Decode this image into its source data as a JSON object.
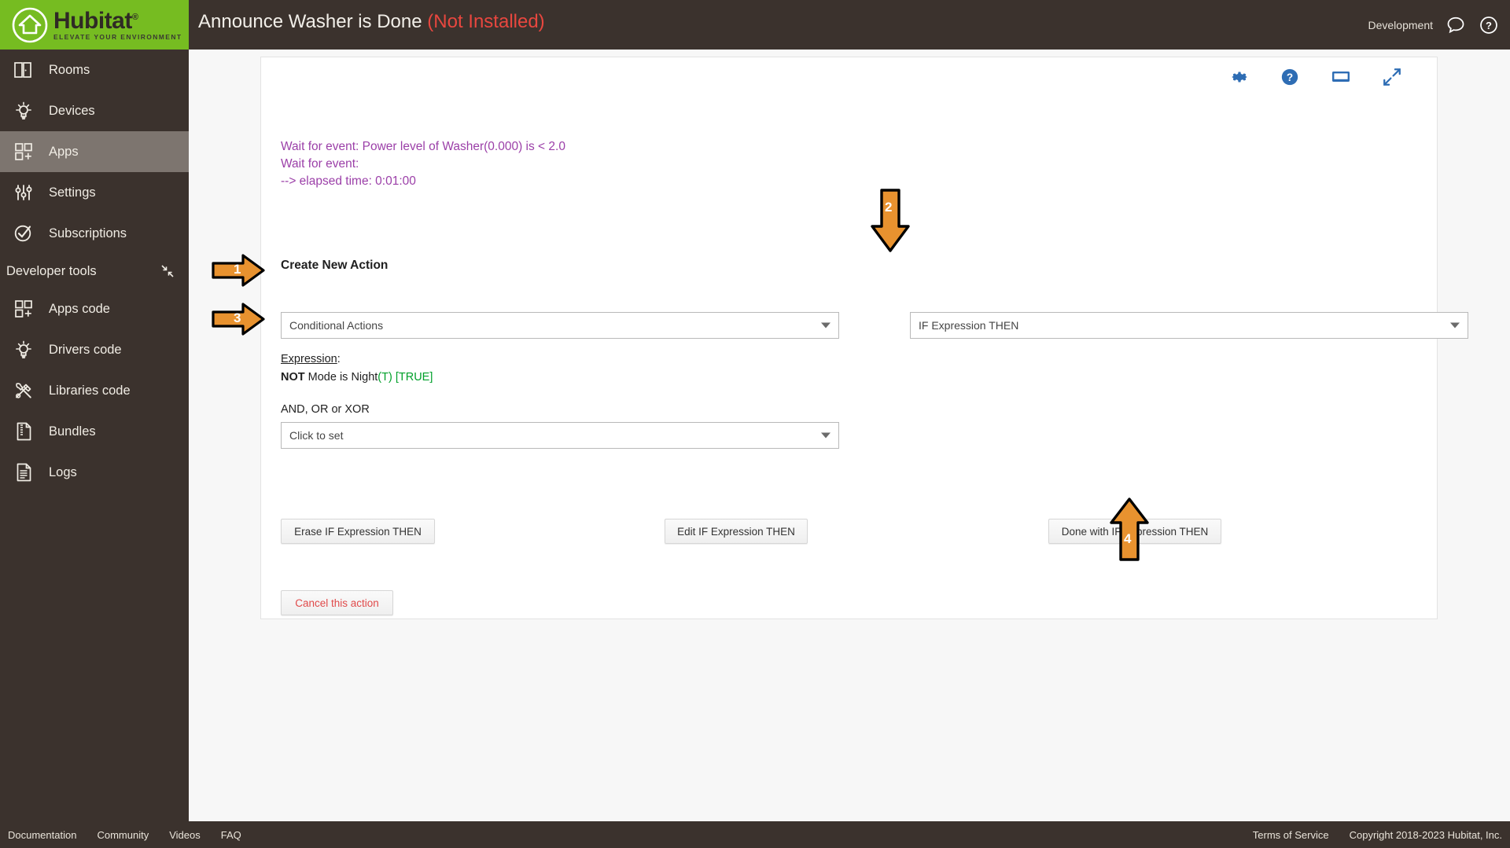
{
  "header": {
    "brand_name": "Hubitat",
    "brand_registered": "®",
    "brand_tagline": "ELEVATE YOUR ENVIRONMENT",
    "app_title": "Announce Washer is Done",
    "app_status": "(Not Installed)",
    "environment": "Development",
    "chat_icon": "chat-bubble-icon",
    "help_icon": "question-circle-icon",
    "brand_green": "#76bc21",
    "bar_color": "#3b322d"
  },
  "sidebar": {
    "items": [
      {
        "label": "Rooms",
        "icon": "rooms-icon",
        "active": false
      },
      {
        "label": "Devices",
        "icon": "devices-bulb-icon",
        "active": false
      },
      {
        "label": "Apps",
        "icon": "apps-grid-icon",
        "active": true
      },
      {
        "label": "Settings",
        "icon": "sliders-icon",
        "active": false
      },
      {
        "label": "Subscriptions",
        "icon": "check-circle-icon",
        "active": false
      }
    ],
    "section_label": "Developer tools",
    "collapse_icon": "collapse-arrows-icon",
    "dev_items": [
      {
        "label": "Apps code",
        "icon": "apps-grid-icon"
      },
      {
        "label": "Drivers code",
        "icon": "devices-bulb-icon"
      },
      {
        "label": "Libraries code",
        "icon": "tools-icon"
      },
      {
        "label": "Bundles",
        "icon": "zip-file-icon"
      },
      {
        "label": "Logs",
        "icon": "document-lines-icon"
      }
    ]
  },
  "card": {
    "tool_icons": [
      "gear-icon",
      "help-circle-icon",
      "display-icon",
      "expand-icon"
    ],
    "accent_blue": "#2e6db4",
    "log_lines": [
      "Wait for event: Power level of Washer(0.000) is < 2.0",
      "Wait for event:",
      " --> elapsed time: 0:01:00"
    ],
    "log_color": "#9b3fa8",
    "create_new_action": "Create New Action",
    "action_select": {
      "value": "Conditional Actions"
    },
    "type_select": {
      "value": "IF Expression THEN"
    },
    "expression_label": "Expression",
    "expression_colon": ":",
    "expression_not": "NOT",
    "expression_body": " Mode is Night",
    "expression_t": "(T)",
    "expression_true": " [TRUE]",
    "logic_label": "AND, OR or XOR",
    "logic_select": {
      "value": "Click to set"
    },
    "buttons": {
      "erase": "Erase IF Expression THEN",
      "edit": "Edit IF Expression THEN",
      "done": "Done with IF Expression THEN",
      "cancel": "Cancel this action"
    }
  },
  "annotations": {
    "color": "#e8922f",
    "markers": [
      {
        "number": "1",
        "direction": "right"
      },
      {
        "number": "2",
        "direction": "down"
      },
      {
        "number": "3",
        "direction": "right"
      },
      {
        "number": "4",
        "direction": "up"
      }
    ]
  },
  "footer": {
    "links": [
      "Documentation",
      "Community",
      "Videos",
      "FAQ"
    ],
    "terms": "Terms of Service",
    "copyright": "Copyright 2018-2023 Hubitat, Inc."
  }
}
